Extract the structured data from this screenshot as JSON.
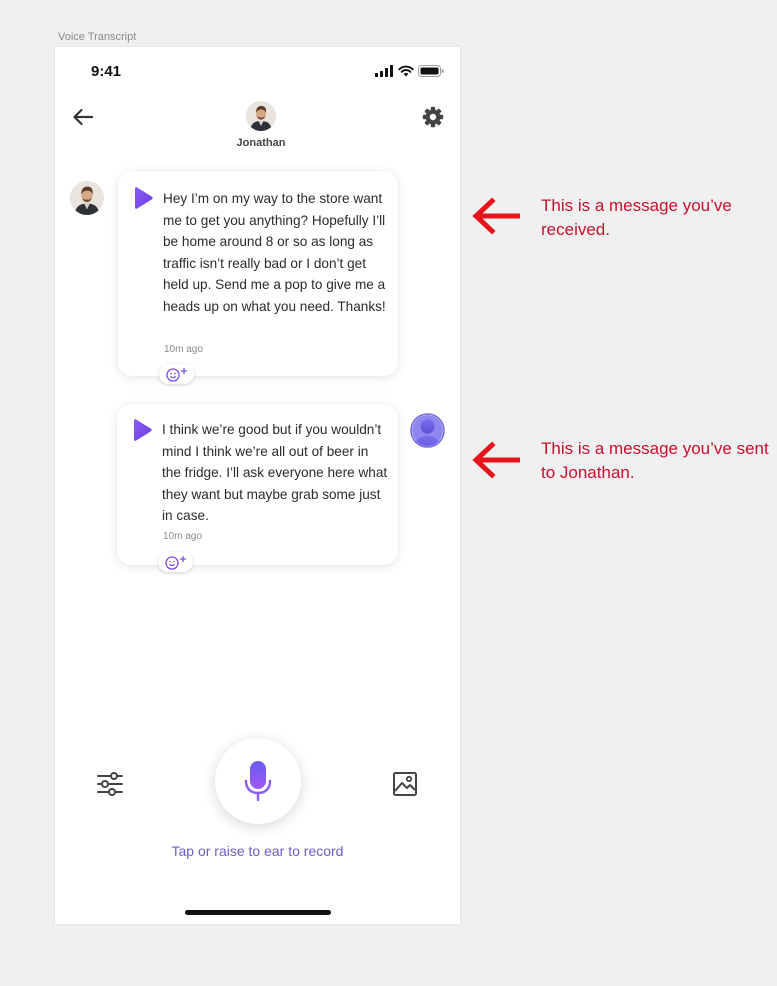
{
  "frame_label": "Voice Transcript",
  "status_bar": {
    "time": "9:41"
  },
  "header": {
    "contact_name": "Jonathan"
  },
  "messages": [
    {
      "direction": "received",
      "text": "Hey I’m on my way to the store want me to get you anything? Hopefully I’ll be home around 8 or so as long as traffic isn’t really bad or I don’t get held up. Send me a pop to give me a heads up on what you need. Thanks!",
      "time": "10m ago"
    },
    {
      "direction": "sent",
      "text": "I think we’re good but if you wouldn’t mind I think we’re all out of beer in the fridge. I’ll ask everyone here what they want but maybe grab some just in case.",
      "time": "10m ago"
    }
  ],
  "composer": {
    "hint": "Tap or raise to ear to record"
  },
  "annotations": [
    {
      "text": "This is a message you’ve received."
    },
    {
      "text": "This is a message you’ve sent to Jonathan."
    }
  ],
  "colors": {
    "accent_purple": "#7b4ee8",
    "hint_text": "#6b5fc4",
    "annotation_red": "#c8102e",
    "arrow_red": "#e8141c"
  },
  "icons": {
    "back": "arrow-left-icon",
    "settings": "gear-icon",
    "play": "play-icon",
    "reaction": "add-reaction-icon",
    "filters": "sliders-icon",
    "image": "image-icon",
    "mic": "microphone-icon"
  }
}
